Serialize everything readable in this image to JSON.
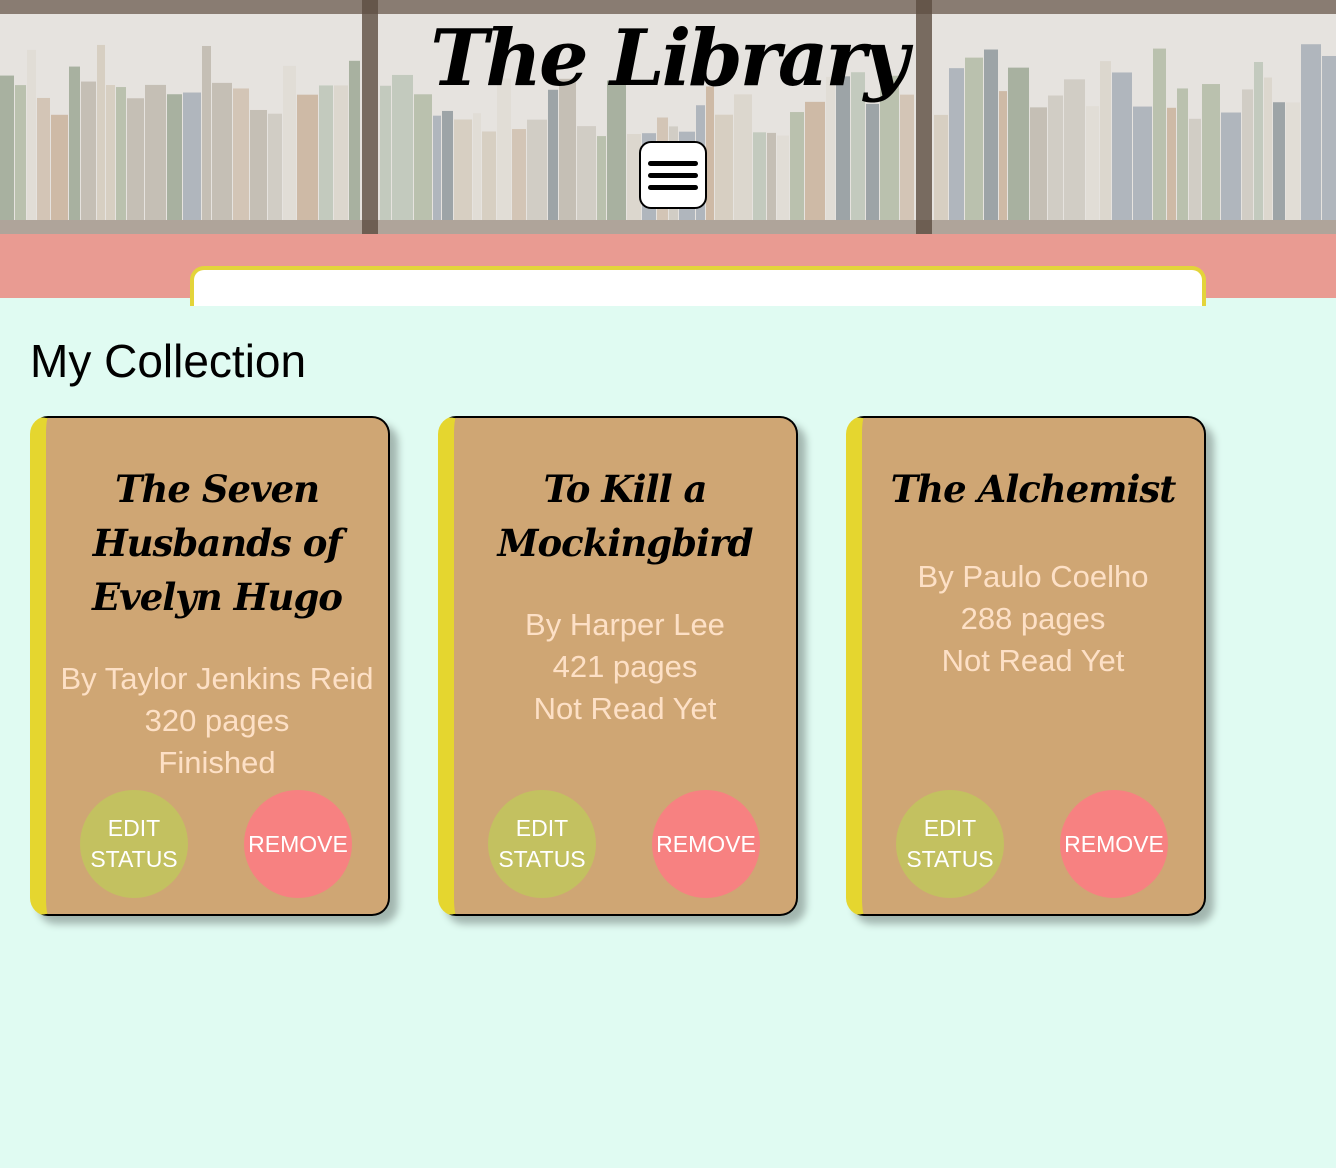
{
  "header": {
    "title": "The Library"
  },
  "main": {
    "heading": "My Collection"
  },
  "books": [
    {
      "title": "The Seven Husbands of Evelyn Hugo",
      "author": "By Taylor Jenkins Reid",
      "pages": "320 pages",
      "status": "Finished",
      "edit_label": "Edit Status",
      "remove_label": "Remove"
    },
    {
      "title": "To Kill a Mockingbird",
      "author": "By Harper Lee",
      "pages": "421 pages",
      "status": "Not Read Yet",
      "edit_label": "Edit Status",
      "remove_label": "Remove"
    },
    {
      "title": "The Alchemist",
      "author": "By Paulo Coelho",
      "pages": "288 pages",
      "status": "Not Read Yet",
      "edit_label": "Edit Status",
      "remove_label": "Remove"
    }
  ],
  "colors": {
    "page_background": "#e0fbf2",
    "header_band": "#e99b92",
    "card": "#cfa674",
    "card_spine": "#e5d62f",
    "edit_button": "#c3c160",
    "remove_button": "#f78181",
    "book_info_text": "#fde0c6"
  },
  "icons": {
    "menu": "hamburger-menu-icon"
  }
}
